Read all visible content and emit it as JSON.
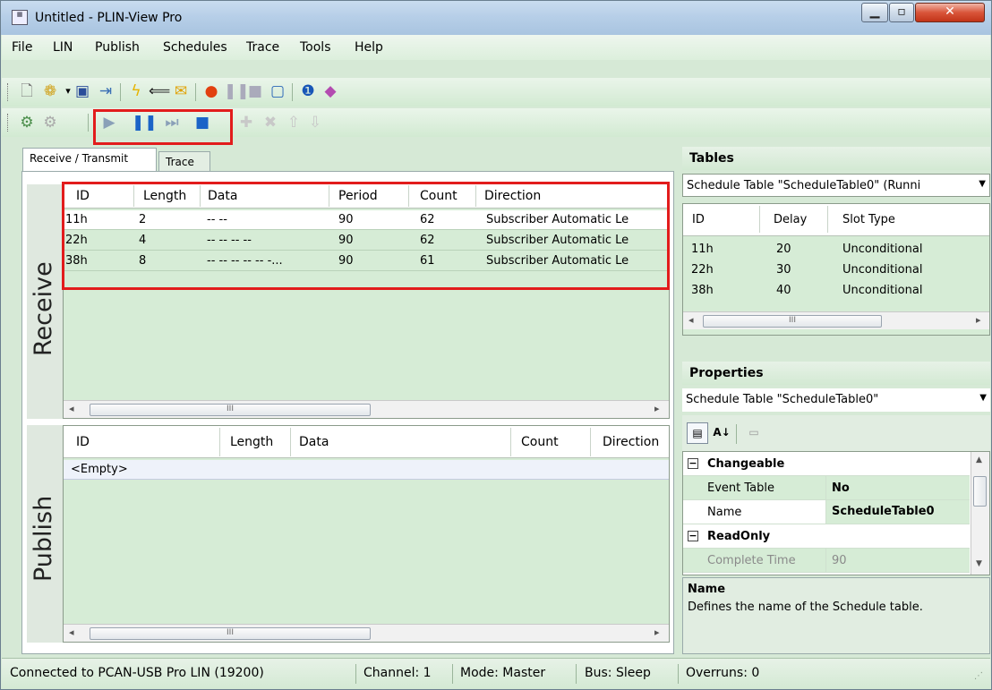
{
  "window": {
    "title": "Untitled - PLIN-View Pro",
    "min_icon": "minimize-glyph",
    "max_icon": "maximize-glyph",
    "close_icon": "close-glyph"
  },
  "menu": [
    "File",
    "LIN",
    "Publish",
    "Schedules",
    "Trace",
    "Tools",
    "Help"
  ],
  "toolbar1": [
    "new-file-icon",
    "open-icon",
    "dropdown-arrow-icon",
    "save-icon",
    "import-icon",
    "connect-icon",
    "transmit-icon",
    "mail-icon",
    "record-icon",
    "pause-icon",
    "stop-icon",
    "save-trace-icon",
    "info-icon",
    "help-book-icon"
  ],
  "toolbar2": [
    "add-publisher-icon",
    "remove-publisher-icon",
    "play-icon",
    "pause-icon",
    "step-icon",
    "stop-icon",
    "add-icon",
    "delete-icon",
    "move-up-icon",
    "move-down-icon"
  ],
  "colors": {
    "accent_red": "#e21c1c",
    "grid_green": "#d6ecd6"
  },
  "tabs": {
    "receive_transmit": "Receive / Transmit",
    "trace": "Trace"
  },
  "receive": {
    "label": "Receive",
    "columns": [
      "ID",
      "Length",
      "Data",
      "Period",
      "Count",
      "Direction"
    ],
    "rows": [
      {
        "id": "11h",
        "length": "2",
        "data": "-- --",
        "period": "90",
        "count": "62",
        "direction": "Subscriber Automatic Le"
      },
      {
        "id": "22h",
        "length": "4",
        "data": "-- -- -- --",
        "period": "90",
        "count": "62",
        "direction": "Subscriber Automatic Le"
      },
      {
        "id": "38h",
        "length": "8",
        "data": "-- -- -- -- -- -...",
        "period": "90",
        "count": "61",
        "direction": "Subscriber Automatic Le"
      }
    ]
  },
  "publish": {
    "label": "Publish",
    "columns": [
      "ID",
      "Length",
      "Data",
      "Count",
      "Direction"
    ],
    "empty_text": "<Empty>"
  },
  "scroll_thumb": "III",
  "tables": {
    "title": "Tables",
    "selector": "Schedule Table \"ScheduleTable0\" (Runni",
    "columns": [
      "ID",
      "Delay",
      "Slot Type"
    ],
    "rows": [
      {
        "id": "11h",
        "delay": "20",
        "slot": "Unconditional"
      },
      {
        "id": "22h",
        "delay": "30",
        "slot": "Unconditional"
      },
      {
        "id": "38h",
        "delay": "40",
        "slot": "Unconditional"
      }
    ]
  },
  "properties": {
    "title": "Properties",
    "selector": "Schedule Table \"ScheduleTable0\"",
    "categories": [
      {
        "name": "Changeable",
        "toggle": "−"
      },
      {
        "name": "ReadOnly",
        "toggle": "−"
      }
    ],
    "items": [
      {
        "name": "Event Table",
        "value": "No"
      },
      {
        "name": "Name",
        "value": "ScheduleTable0"
      },
      {
        "name": "Complete Time",
        "value": "90"
      }
    ],
    "desc_title": "Name",
    "desc_text": "Defines the name of the Schedule table."
  },
  "status": {
    "connection": "Connected to PCAN-USB Pro LIN (19200)",
    "channel": "Channel: 1",
    "mode": "Mode: Master",
    "bus": "Bus: Sleep",
    "overruns": "Overruns: 0"
  }
}
